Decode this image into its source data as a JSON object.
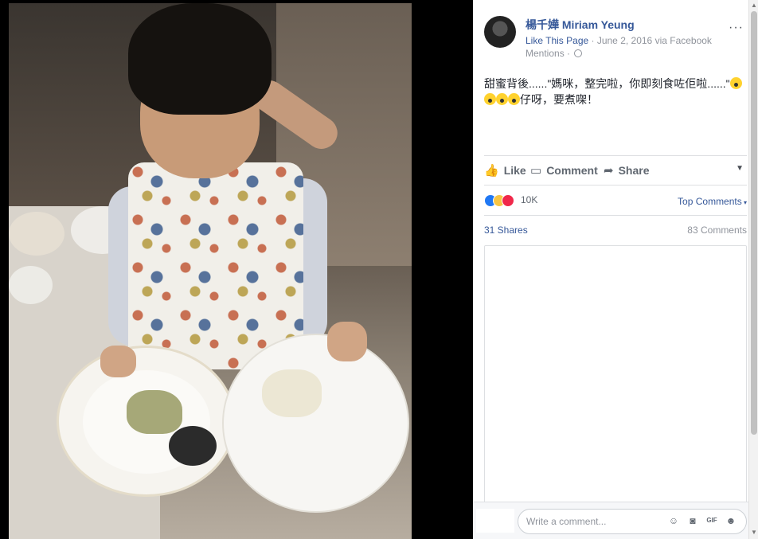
{
  "post": {
    "author": "楊千嬅 Miriam Yeung",
    "like_page": "Like This Page",
    "meta_rest": " · June 2, 2016 via Facebook Mentions · ",
    "text_line1": "甜蜜背後......\"媽咪，整完啦，你即刻食咗佢啦......\"",
    "text_line2": "仔呀，要煮㗎！",
    "more_label": "···"
  },
  "actions": {
    "like": "Like",
    "comment": "Comment",
    "share": "Share"
  },
  "reactions": {
    "count": "10K",
    "top_comments": "Top Comments"
  },
  "stats": {
    "shares": "31 Shares",
    "comments": "83 Comments"
  },
  "comment_input": {
    "placeholder": "Write a comment..."
  },
  "icons": [
    "thumbs-up-icon",
    "comment-icon",
    "share-icon",
    "globe-icon",
    "emoji-icon",
    "camera-icon",
    "gif-icon",
    "sticker-icon",
    "scared-emoji-icon"
  ],
  "colors": {
    "link_blue": "#365899",
    "text_gray": "#606770",
    "like_blue": "#2078f4",
    "haha_yellow": "#f7c544",
    "love_red": "#f0284a"
  }
}
